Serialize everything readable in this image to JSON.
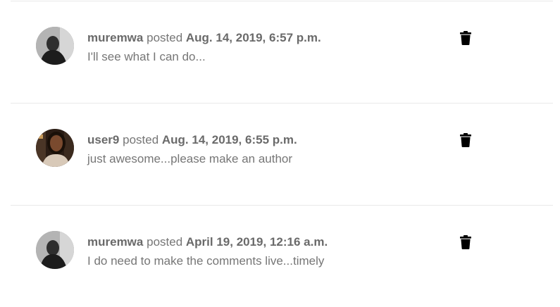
{
  "comments": [
    {
      "author": "muremwa",
      "verb": "posted",
      "date": "Aug. 14, 2019, 6:57 p.m.",
      "text": "I'll see what I can do...",
      "avatar_icon": "user-avatar-grayscale",
      "delete_icon": "trash-icon"
    },
    {
      "author": "user9",
      "verb": "posted",
      "date": "Aug. 14, 2019, 6:55 p.m.",
      "text": "just awesome...please make an author",
      "avatar_icon": "user-avatar-color",
      "delete_icon": "trash-icon"
    },
    {
      "author": "muremwa",
      "verb": "posted",
      "date": "April 19, 2019, 12:16 a.m.",
      "text": "I do need to make the comments live...timely",
      "avatar_icon": "user-avatar-grayscale",
      "delete_icon": "trash-icon"
    }
  ],
  "colors": {
    "text": "#767676",
    "divider": "#e9e9e9",
    "icon": "#000000"
  }
}
